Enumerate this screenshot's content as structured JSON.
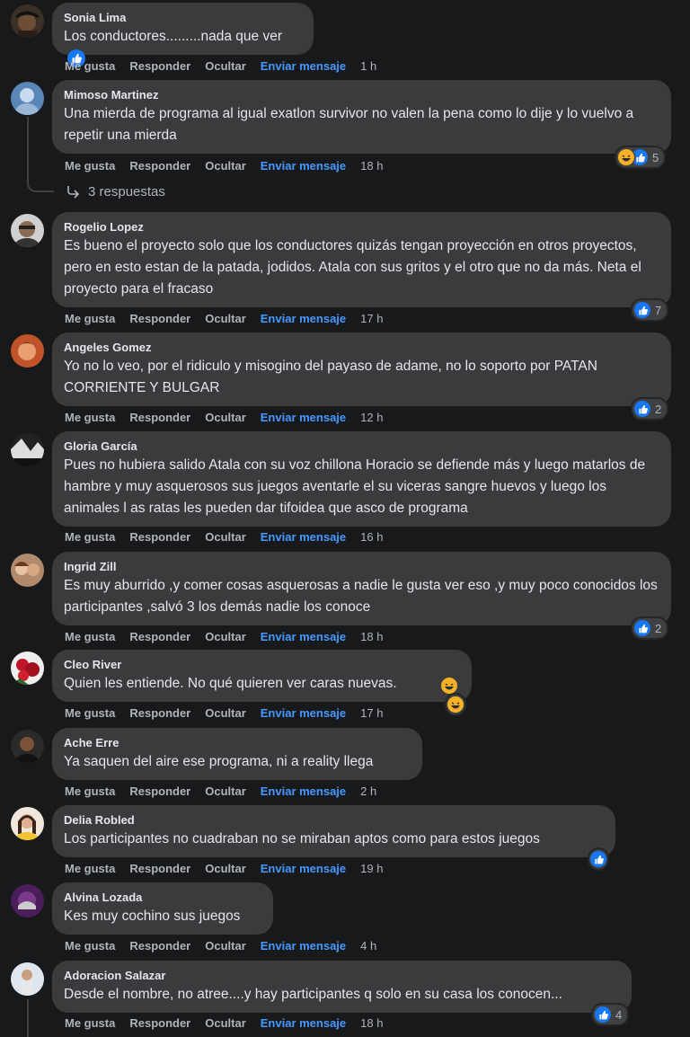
{
  "actions": {
    "like": "Me gusta",
    "reply": "Responder",
    "hide": "Ocultar",
    "send": "Enviar mensaje"
  },
  "comments": [
    {
      "author": "Sonia Lima",
      "text": "Los conductores.........nada que ver",
      "time": "1 h",
      "reactions": ""
    },
    {
      "author": "Mimoso Martinez",
      "text": "Una mierda de programa al igual exatlon survivor no valen la pena como lo dije y lo vuelvo a repetir una mierda",
      "time": "18 h",
      "reactions": "5"
    },
    {
      "author": "Rogelio Lopez",
      "text": "Es bueno el proyecto solo que los conductores quizás tengan proyección en otros proyectos, pero en esto estan de la patada, jodidos. Atala con sus gritos y el otro que no da más. Neta el proyecto para el fracaso",
      "time": "17 h",
      "reactions": "7"
    },
    {
      "author": "Angeles Gomez",
      "text": "Yo no lo veo, por el ridiculo y misogino del payaso de adame, no lo soporto por PATAN CORRIENTE Y BULGAR",
      "time": "12 h",
      "reactions": "2"
    },
    {
      "author": "Gloria García",
      "text": "Pues no hubiera salido Atala con su voz chillona Horacio se defiende más y luego matarlos de hambre y muy asquerosos sus juegos aventarle el su viceras sangre huevos y luego los animales l as ratas les pueden dar tifoidea que asco de programa",
      "time": "16 h",
      "reactions": ""
    },
    {
      "author": "Ingrid Zill",
      "text": "Es muy aburrido ,y comer cosas asquerosas a nadie le gusta ver eso ,y muy poco conocidos los participantes ,salvó 3 los demás nadie los conoce",
      "time": "18 h",
      "reactions": "2"
    },
    {
      "author": "Cleo River",
      "text": "Quien les entiende. No qué quieren ver caras nuevas.",
      "time": "17 h",
      "reactions": ""
    },
    {
      "author": "Ache Erre",
      "text": "Ya saquen del aire ese programa, ni a reality llega",
      "time": "2 h",
      "reactions": ""
    },
    {
      "author": "Delia Robled",
      "text": "Los participantes no cuadraban no se miraban aptos como para estos juegos",
      "time": "19 h",
      "reactions": ""
    },
    {
      "author": "Alvina Lozada",
      "text": "Kes muy cochino sus juegos",
      "time": "4 h",
      "reactions": ""
    },
    {
      "author": "Adoracion Salazar",
      "text": "Desde el nombre, no atree....y hay participantes q solo en su casa los conocen...",
      "time": "18 h",
      "reactions": "4"
    }
  ],
  "replies_label": "3 respuestas",
  "colors": {
    "background": "#18191a",
    "bubble": "#3a3b3c",
    "link": "#4599ff",
    "like": "#1877f2"
  }
}
